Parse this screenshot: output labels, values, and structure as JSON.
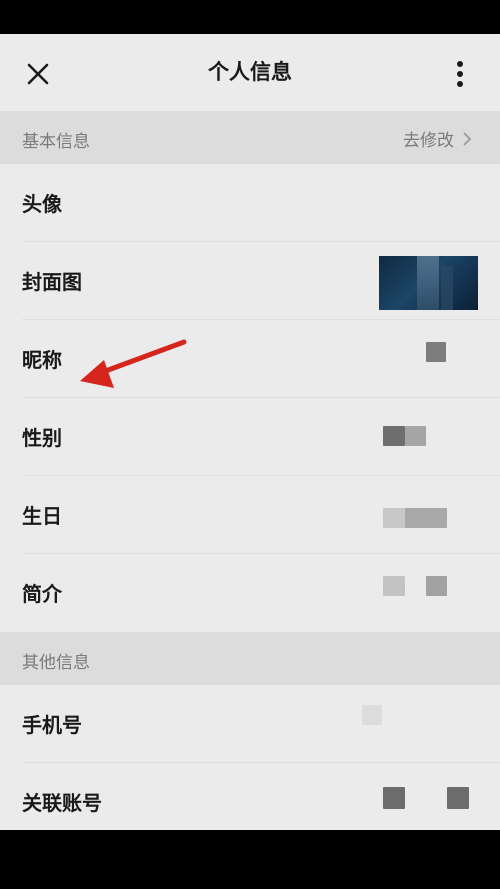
{
  "header": {
    "title": "个人信息",
    "close_icon": "close-icon",
    "more_icon": "more-vertical-icon"
  },
  "basic_section": {
    "label": "基本信息",
    "action_label": "去修改",
    "action_icon": "chevron-right-icon"
  },
  "basic_rows": [
    {
      "label": "头像"
    },
    {
      "label": "封面图"
    },
    {
      "label": "昵称"
    },
    {
      "label": "性别"
    },
    {
      "label": "生日"
    },
    {
      "label": "简介"
    }
  ],
  "other_section": {
    "label": "其他信息"
  },
  "other_rows": [
    {
      "label": "手机号"
    },
    {
      "label": "关联账号"
    }
  ],
  "annotation": {
    "arrow_color": "#d6251c",
    "arrow_icon": "red-arrow-annotation"
  },
  "colors": {
    "background": "#ebebeb",
    "section_bg": "#dcdcdc",
    "text_primary": "#1a1a1a",
    "text_secondary": "#7a7a7a"
  }
}
